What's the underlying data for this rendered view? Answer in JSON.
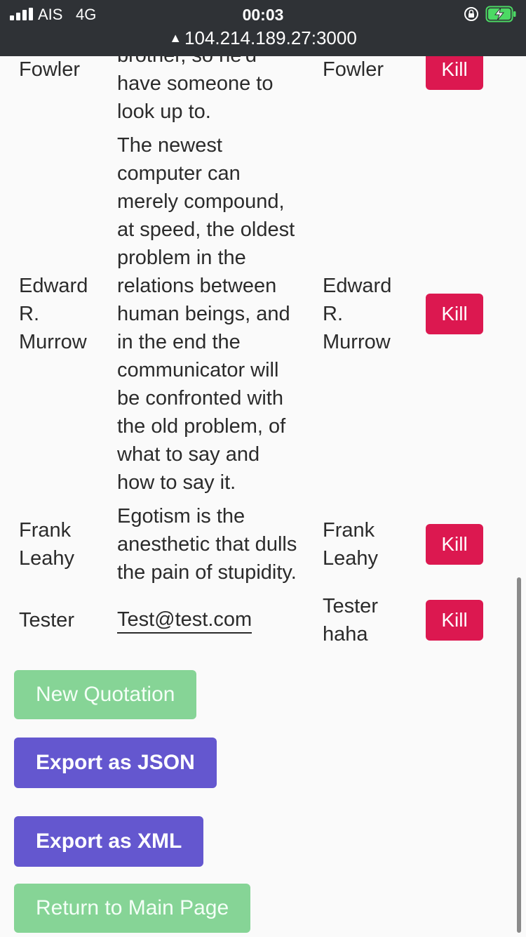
{
  "status_bar": {
    "carrier": "AIS",
    "network": "4G",
    "time": "00:03",
    "url": "104.214.189.27:3000",
    "icons": [
      "signal-icon",
      "warning-icon",
      "orientation-lock-icon",
      "battery-charging-icon"
    ],
    "battery_color": "#4cd964"
  },
  "quotes": {
    "rows": [
      {
        "author_lines": [
          "Fowler"
        ],
        "quote_lines": [
          "brother, so he'd",
          "have someone to",
          "look up to."
        ],
        "who_lines": [
          "Fowler"
        ],
        "action_label": "Kill"
      },
      {
        "author_lines": [
          "Edward",
          "R.",
          "Murrow"
        ],
        "quote_lines": [
          "The newest",
          "computer can",
          "merely compound,",
          "at speed, the oldest",
          "problem in the",
          "relations between",
          "human beings, and",
          "in the end the",
          "communicator will",
          "be confronted with",
          "the old problem, of",
          "what to say and",
          "how to say it."
        ],
        "who_lines": [
          "Edward",
          "R.",
          "Murrow"
        ],
        "action_label": "Kill"
      },
      {
        "author_lines": [
          "Frank",
          "Leahy"
        ],
        "quote_lines": [
          "Egotism is the",
          "anesthetic that dulls",
          "the pain of stupidity."
        ],
        "who_lines": [
          "Frank",
          "Leahy"
        ],
        "action_label": "Kill"
      },
      {
        "author_lines": [
          "Tester"
        ],
        "email": "Test@test.com",
        "who_lines": [
          "Tester",
          "haha"
        ],
        "action_label": "Kill"
      }
    ]
  },
  "actions": {
    "new_quotation": "New Quotation",
    "export_json": "Export as JSON",
    "export_xml": "Export as XML",
    "return_main": "Return to Main Page"
  },
  "colors": {
    "kill": "#dc1850",
    "light_green": "#86d496",
    "purple": "#6457cf",
    "status_bar": "#2f3236",
    "page_background": "#fafafa"
  }
}
